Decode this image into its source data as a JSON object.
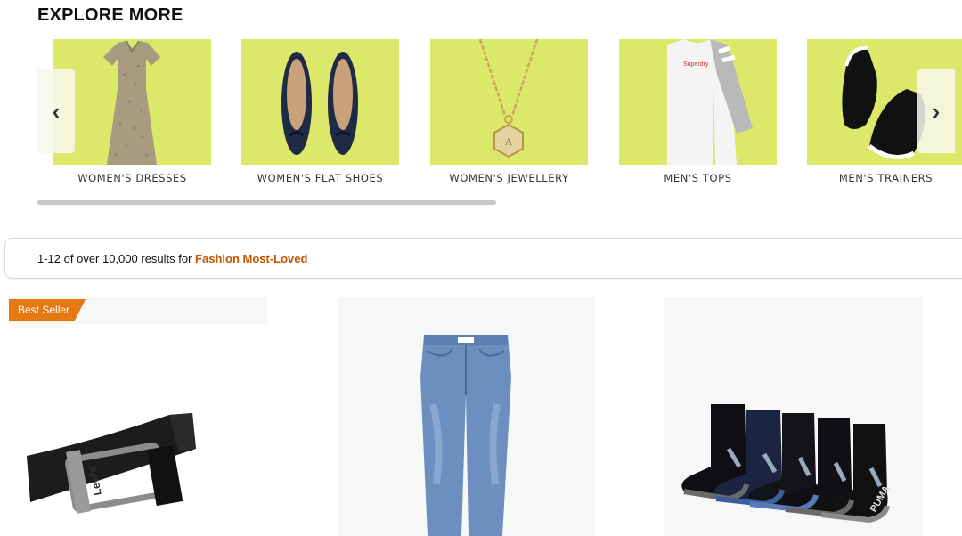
{
  "explore": {
    "title": "EXPLORE MORE",
    "tile_bg": "#dbe86a",
    "categories": [
      {
        "label": "WOMEN'S DRESSES",
        "icon": "dress-icon"
      },
      {
        "label": "WOMEN'S FLAT SHOES",
        "icon": "flat-shoes-icon"
      },
      {
        "label": "WOMEN'S JEWELLERY",
        "icon": "necklace-icon"
      },
      {
        "label": "MEN'S TOPS",
        "icon": "top-icon"
      },
      {
        "label": "MEN'S TRAINERS",
        "icon": "trainers-icon"
      }
    ],
    "prev_arrow": "‹",
    "next_arrow": "›"
  },
  "results": {
    "summary": "1-12 of over 10,000 results for ",
    "query": "Fashion Most-Loved",
    "query_color": "#c45500"
  },
  "products": [
    {
      "badge": "Best Seller",
      "image": "belt-image",
      "brand_mark": "Levi's"
    },
    {
      "image": "jeans-image"
    },
    {
      "image": "socks-image",
      "brand_mark": "PUMA"
    }
  ]
}
